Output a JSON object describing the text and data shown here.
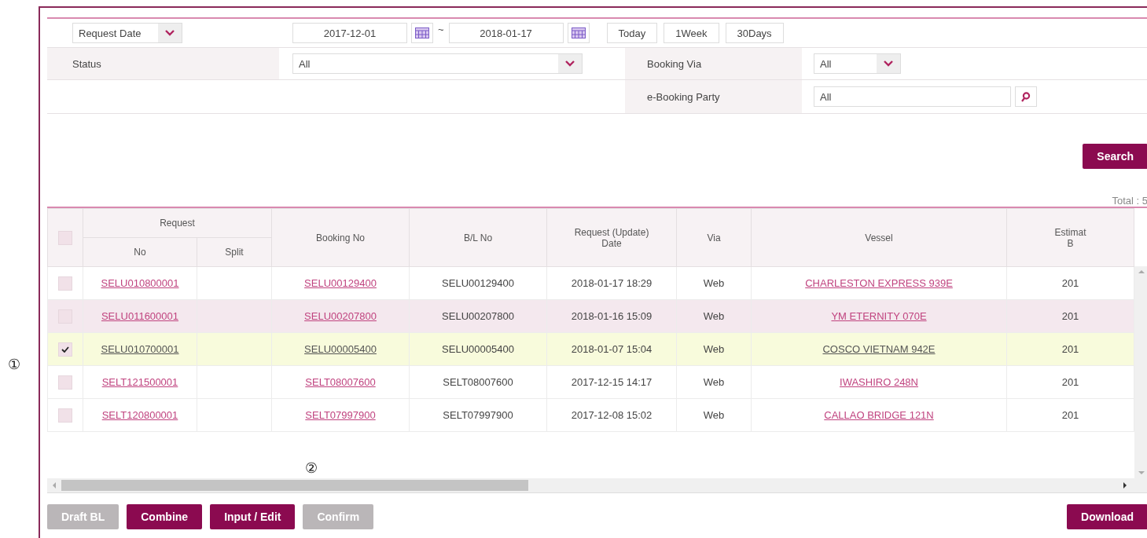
{
  "filters": {
    "date_type": {
      "value": "Request Date"
    },
    "date_from": "2017-12-01",
    "separator": "~",
    "date_to": "2018-01-17",
    "ranges": [
      "Today",
      "1Week",
      "30Days"
    ],
    "status": {
      "label": "Status",
      "value": "All"
    },
    "booking_via": {
      "label": "Booking Via",
      "value": "All"
    },
    "e_booking_party": {
      "label": "e-Booking Party",
      "value": "All"
    }
  },
  "search_button": "Search",
  "total": "Total : 5",
  "table": {
    "group_header": "Request",
    "header_checked": false,
    "columns": [
      "No",
      "Split",
      "Booking No",
      "B/L No",
      "Request (Update)\nDate",
      "Via",
      "Vessel",
      "Estimat\nB"
    ],
    "rows": [
      {
        "checked": false,
        "selected": false,
        "hovered": false,
        "request_no": "SELU010800001",
        "booking_no": "SELU00129400",
        "bl_no": "SELU00129400",
        "date": "2018-01-17 18:29",
        "via": "Web",
        "vessel": "CHARLESTON EXPRESS 939E",
        "column_9": "201"
      },
      {
        "checked": false,
        "selected": false,
        "hovered": true,
        "request_no": "SELU011600001",
        "booking_no": "SELU00207800",
        "bl_no": "SELU00207800",
        "date": "2018-01-16 15:09",
        "via": "Web",
        "vessel": "YM ETERNITY 070E",
        "column_9": "201"
      },
      {
        "checked": true,
        "selected": true,
        "hovered": false,
        "request_no": "SELU010700001",
        "booking_no": "SELU00005400",
        "bl_no": "SELU00005400",
        "date": "2018-01-07 15:04",
        "via": "Web",
        "vessel": "COSCO VIETNAM 942E",
        "column_9": "201"
      },
      {
        "checked": false,
        "selected": false,
        "hovered": false,
        "request_no": "SELT121500001",
        "booking_no": "SELT08007600",
        "bl_no": "SELT08007600",
        "date": "2017-12-15 14:17",
        "via": "Web",
        "vessel": "IWASHIRO 248N",
        "column_9": "201"
      },
      {
        "checked": false,
        "selected": false,
        "hovered": false,
        "request_no": "SELT120800001",
        "booking_no": "SELT07997900",
        "bl_no": "SELT07997900",
        "date": "2017-12-08 15:02",
        "via": "Web",
        "vessel": "CALLAO BRIDGE 121N",
        "column_9": "201"
      }
    ]
  },
  "buttons": [
    {
      "label": "Draft BL",
      "disabled": true
    },
    {
      "label": "Combine",
      "disabled": false
    },
    {
      "label": "Input / Edit",
      "disabled": false
    },
    {
      "label": "Confirm",
      "disabled": true
    }
  ],
  "download_button": "Download",
  "callouts": [
    "①",
    "②"
  ]
}
